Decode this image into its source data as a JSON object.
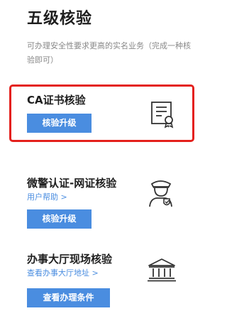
{
  "page": {
    "title": "五级核验",
    "description": "可办理安全性要求更高的实名业务（完成一种核验即可）"
  },
  "cards": [
    {
      "title": "CA证书核验",
      "button_label": "核验升级",
      "icon": "certificate-icon",
      "highlighted": true
    },
    {
      "title": "微警认证-网证核验",
      "link_label": "用户帮助 >",
      "button_label": "核验升级",
      "icon": "police-officer-icon"
    },
    {
      "title": "办事大厅现场核验",
      "link_label": "查看办事大厅地址 >",
      "button_label": "查看办理条件",
      "icon": "government-hall-icon"
    }
  ],
  "colors": {
    "accent": "#4a8de0",
    "highlight": "#e4201c",
    "title": "#1f1f1f",
    "muted": "#888888"
  }
}
